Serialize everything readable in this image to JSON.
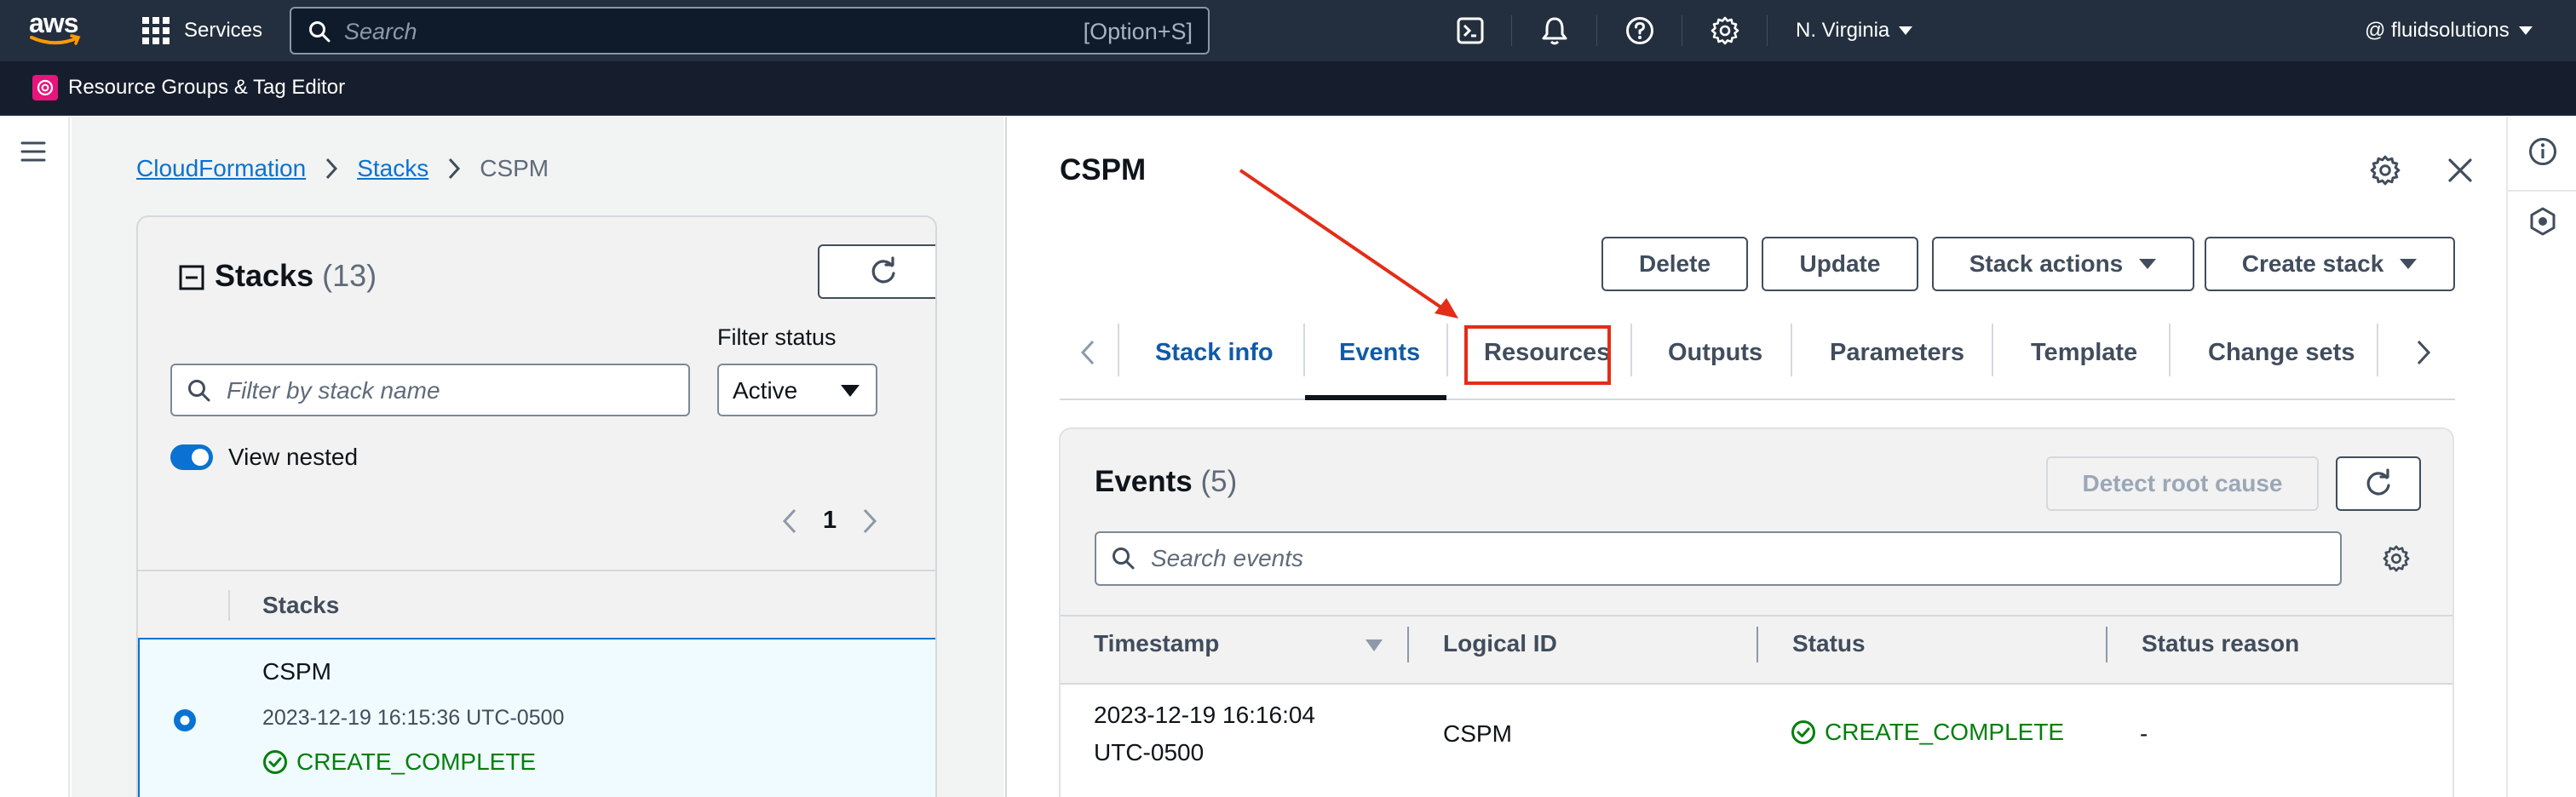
{
  "topnav": {
    "services_label": "Services",
    "search_placeholder": "Search",
    "search_shortcut": "[Option+S]",
    "region_label": "N. Virginia",
    "account_label": "@ fluidsolutions"
  },
  "subnav": {
    "favorite_label": "Resource Groups & Tag Editor"
  },
  "breadcrumb": {
    "items": [
      "CloudFormation",
      "Stacks",
      "CSPM"
    ]
  },
  "stacks_panel": {
    "title": "Stacks",
    "count": "(13)",
    "filter_placeholder": "Filter by stack name",
    "filter_status_label": "Filter status",
    "filter_status_value": "Active",
    "view_nested_label": "View nested",
    "page_number": "1",
    "column_header": "Stacks",
    "rows": [
      {
        "name": "CSPM",
        "timestamp": "2023-12-19 16:15:36 UTC-0500",
        "status": "CREATE_COMPLETE"
      }
    ]
  },
  "detail": {
    "title": "CSPM",
    "buttons": {
      "delete": "Delete",
      "update": "Update",
      "stack_actions": "Stack actions",
      "create_stack": "Create stack"
    },
    "tabs": [
      "Stack info",
      "Events",
      "Resources",
      "Outputs",
      "Parameters",
      "Template",
      "Change sets"
    ],
    "active_tab": "Events",
    "highlighted_tab": "Resources"
  },
  "events_panel": {
    "title": "Events",
    "count": "(5)",
    "detect_root_cause_label": "Detect root cause",
    "search_placeholder": "Search events",
    "columns": [
      "Timestamp",
      "Logical ID",
      "Status",
      "Status reason"
    ],
    "rows": [
      {
        "timestamp_line1": "2023-12-19 16:16:04",
        "timestamp_line2": "UTC-0500",
        "logical_id": "CSPM",
        "status": "CREATE_COMPLETE",
        "status_reason": "-"
      }
    ]
  },
  "colors": {
    "nav_bg": "#232f3e",
    "link_blue": "#0972d3",
    "success_green": "#037f0c",
    "annotation_red": "#e32d17"
  }
}
